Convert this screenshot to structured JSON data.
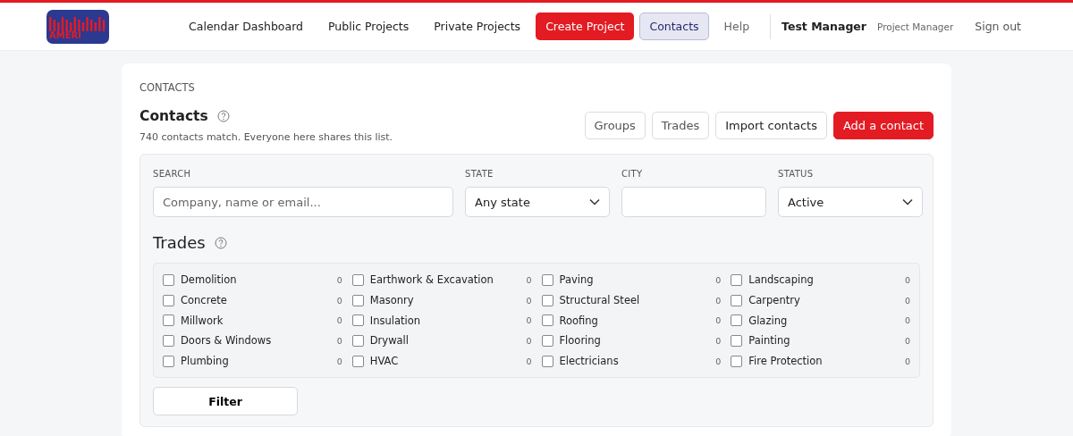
{
  "header": {
    "logo_text": "AMERI",
    "nav": [
      {
        "label": "Calendar Dashboard",
        "kind": "link",
        "selected": false
      },
      {
        "label": "Public Projects",
        "kind": "link",
        "selected": false
      },
      {
        "label": "Private Projects",
        "kind": "link",
        "selected": false
      },
      {
        "label": "Create Project",
        "kind": "primary",
        "selected": false
      },
      {
        "label": "Contacts",
        "kind": "link",
        "selected": true
      },
      {
        "label": "Help",
        "kind": "muted",
        "selected": false
      }
    ],
    "user": {
      "name": "Test Manager",
      "role": "Project Manager"
    },
    "sign_out": "Sign out"
  },
  "breadcrumb": "CONTACTS",
  "title": "Contacts",
  "subtitle": "740 contacts match. Everyone here shares this list.",
  "actions": [
    {
      "label": "Groups",
      "kind": "muted"
    },
    {
      "label": "Trades",
      "kind": "muted"
    },
    {
      "label": "Import contacts",
      "kind": "default"
    },
    {
      "label": "Add a contact",
      "kind": "primary"
    }
  ],
  "filters": {
    "search": {
      "label": "SEARCH",
      "placeholder": "Company, name or email..."
    },
    "state": {
      "label": "STATE",
      "value": "Any state"
    },
    "city": {
      "label": "CITY"
    },
    "status": {
      "label": "STATUS",
      "value": "Active"
    }
  },
  "trades_title": "Trades",
  "trade_columns": [
    [
      {
        "name": "Demolition",
        "count": "0",
        "checked": false
      },
      {
        "name": "Concrete",
        "count": "0",
        "checked": false
      },
      {
        "name": "Millwork",
        "count": "0",
        "checked": false
      },
      {
        "name": "Doors & Windows",
        "count": "0",
        "checked": false
      },
      {
        "name": "Plumbing",
        "count": "0",
        "checked": false
      }
    ],
    [
      {
        "name": "Earthwork & Excavation",
        "count": "0",
        "checked": false
      },
      {
        "name": "Masonry",
        "count": "0",
        "checked": false
      },
      {
        "name": "Insulation",
        "count": "0",
        "checked": false
      },
      {
        "name": "Drywall",
        "count": "0",
        "checked": false
      },
      {
        "name": "HVAC",
        "count": "0",
        "checked": false
      }
    ],
    [
      {
        "name": "Paving",
        "count": "0",
        "checked": false
      },
      {
        "name": "Structural Steel",
        "count": "0",
        "checked": false
      },
      {
        "name": "Roofing",
        "count": "0",
        "checked": false
      },
      {
        "name": "Flooring",
        "count": "0",
        "checked": false
      },
      {
        "name": "Electricians",
        "count": "0",
        "checked": false
      }
    ],
    [
      {
        "name": "Landscaping",
        "count": "0",
        "checked": false
      },
      {
        "name": "Carpentry",
        "count": "0",
        "checked": false
      },
      {
        "name": "Glazing",
        "count": "0",
        "checked": false
      },
      {
        "name": "Painting",
        "count": "0",
        "checked": false
      },
      {
        "name": "Fire Protection",
        "count": "0",
        "checked": false
      }
    ]
  ],
  "filter_button": "Filter"
}
